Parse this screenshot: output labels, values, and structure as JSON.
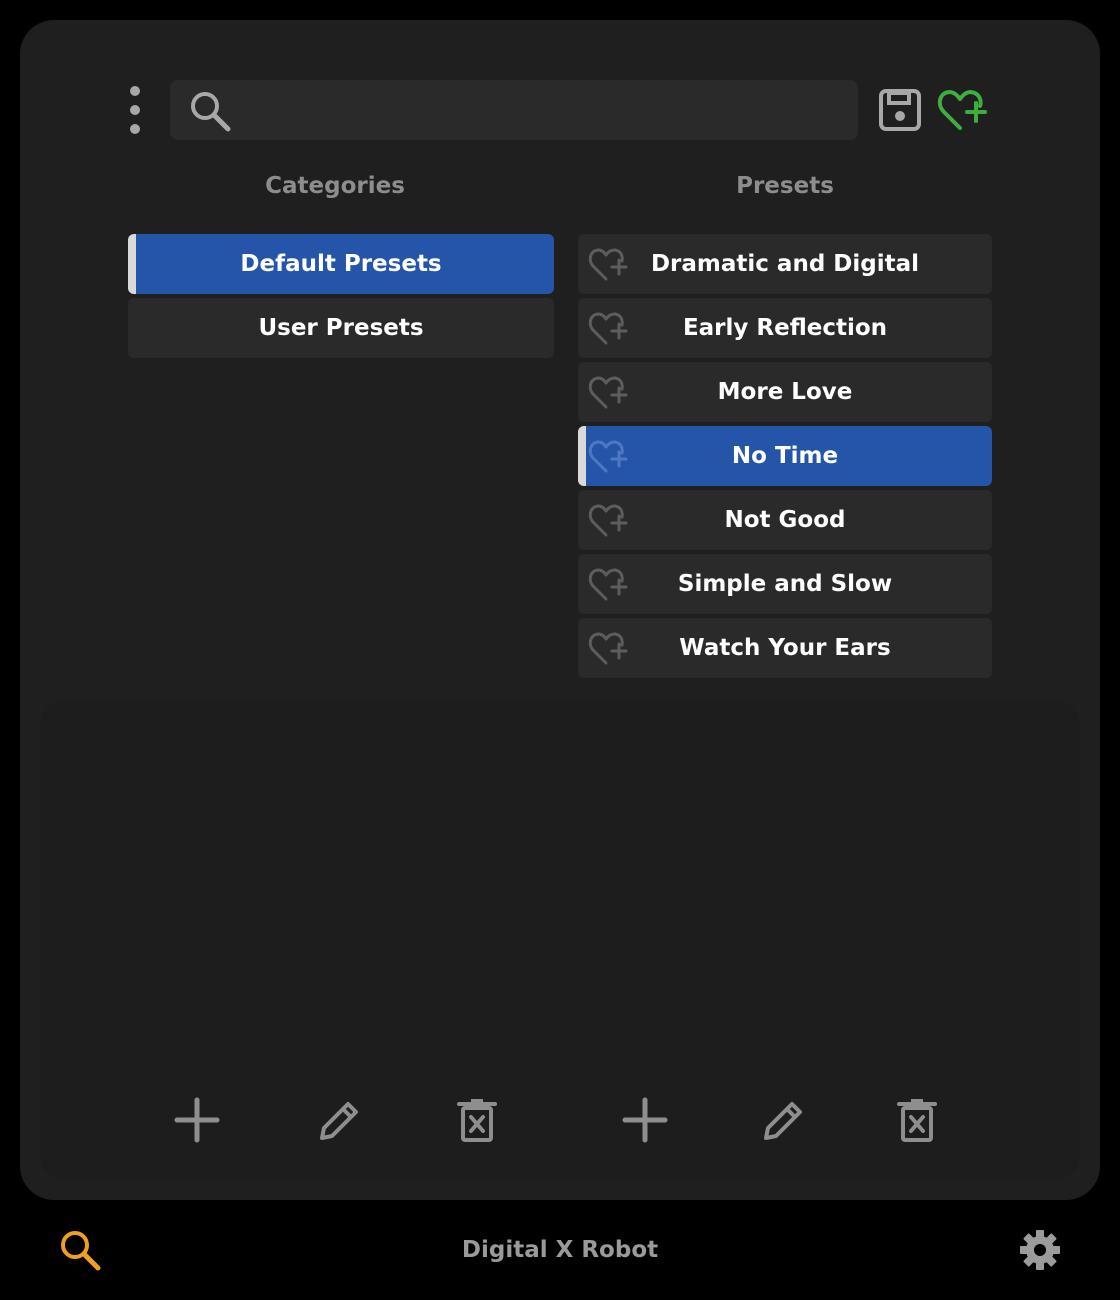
{
  "search": {
    "placeholder": "",
    "value": ""
  },
  "columns": {
    "categories_title": "Categories",
    "presets_title": "Presets"
  },
  "categories": [
    {
      "label": "Default Presets",
      "selected": true
    },
    {
      "label": "User Presets",
      "selected": false
    }
  ],
  "presets": [
    {
      "label": "Dramatic and Digital",
      "selected": false
    },
    {
      "label": "Early Reflection",
      "selected": false
    },
    {
      "label": "More Love",
      "selected": false
    },
    {
      "label": "No Time",
      "selected": true
    },
    {
      "label": "Not Good",
      "selected": false
    },
    {
      "label": "Simple and Slow",
      "selected": false
    },
    {
      "label": "Watch Your Ears",
      "selected": false
    }
  ],
  "footer": {
    "title": "Digital X Robot"
  },
  "colors": {
    "selected": "#2455a8",
    "favorite_accent": "#3fae3f",
    "search_accent": "#f0a020"
  },
  "icons": {
    "menu": "kebab-menu-icon",
    "search": "search-icon",
    "save": "save-icon",
    "add_favorite": "heart-plus-icon",
    "add": "plus-icon",
    "edit": "pencil-icon",
    "delete": "trash-icon",
    "settings": "gear-icon"
  }
}
